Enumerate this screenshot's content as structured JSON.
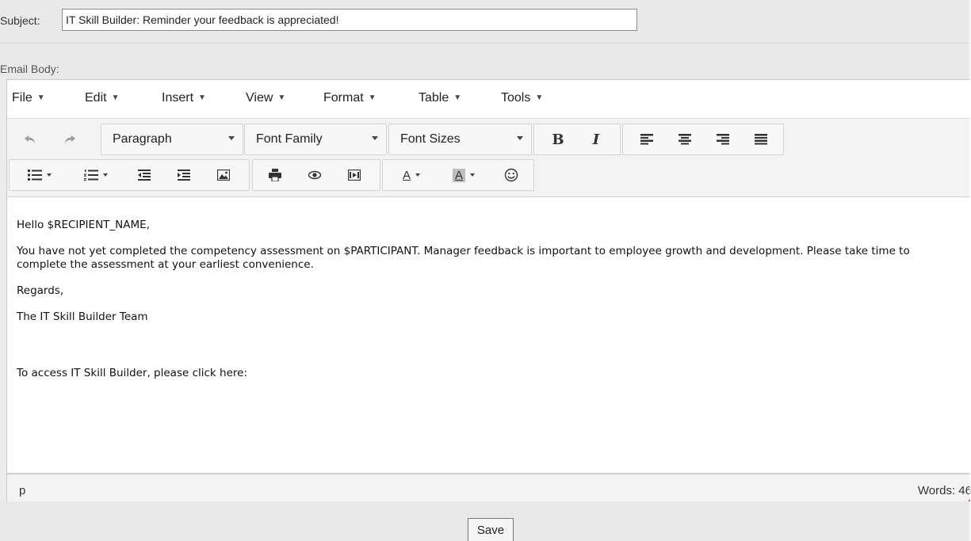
{
  "subject": {
    "label": "Subject:",
    "value": "IT Skill Builder: Reminder your feedback is appreciated!"
  },
  "email_body_label": "Email Body:",
  "menubar": {
    "items": [
      {
        "label": "File"
      },
      {
        "label": "Edit"
      },
      {
        "label": "Insert"
      },
      {
        "label": "View"
      },
      {
        "label": "Format"
      },
      {
        "label": "Table"
      },
      {
        "label": "Tools"
      }
    ]
  },
  "toolbar": {
    "block_format": "Paragraph",
    "font_family": "Font Family",
    "font_sizes": "Font Sizes",
    "bold_label": "B",
    "italic_label": "I",
    "text_color_label": "A",
    "bg_color_label": "A",
    "icons": [
      "undo-icon",
      "redo-icon",
      "align-left-icon",
      "align-center-icon",
      "align-right-icon",
      "align-justify-icon",
      "bullet-list-icon",
      "numbered-list-icon",
      "outdent-icon",
      "indent-icon",
      "image-icon",
      "print-icon",
      "preview-icon",
      "media-icon",
      "emoticons-icon"
    ]
  },
  "content": {
    "greeting": "Hello $RECIPIENT_NAME,",
    "paragraph": "You have not yet completed the competency assessment on $PARTICIPANT. Manager feedback is important to employee growth and development. Please take time to complete the assessment at your earliest convenience.",
    "regards": "Regards,",
    "signature": "The IT Skill Builder Team",
    "access_line": "To access IT Skill Builder, please click here:"
  },
  "statusbar": {
    "path": "p",
    "word_count": "Words: 46"
  },
  "footer": {
    "save_label": "Save"
  }
}
